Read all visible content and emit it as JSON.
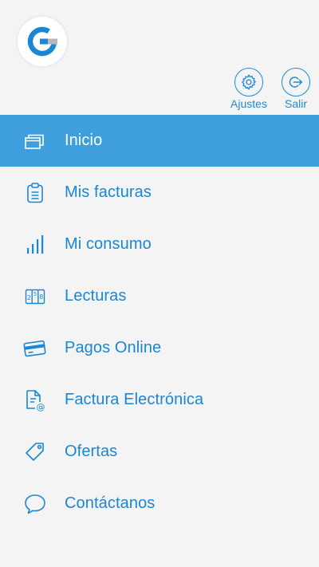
{
  "header": {
    "logo_icon": "brand-logo-icon",
    "actions": [
      {
        "label": "Ajustes",
        "icon": "gear-icon"
      },
      {
        "label": "Salir",
        "icon": "logout-icon"
      }
    ]
  },
  "menu": {
    "active_index": 0,
    "items": [
      {
        "label": "Inicio",
        "icon": "windows-stack-icon"
      },
      {
        "label": "Mis facturas",
        "icon": "clipboard-icon"
      },
      {
        "label": "Mi consumo",
        "icon": "bar-chart-icon"
      },
      {
        "label": "Lecturas",
        "icon": "meter-digits-icon"
      },
      {
        "label": "Pagos Online",
        "icon": "credit-card-icon"
      },
      {
        "label": "Factura Electrónica",
        "icon": "email-document-icon"
      },
      {
        "label": "Ofertas",
        "icon": "tag-icon"
      },
      {
        "label": "Contáctanos",
        "icon": "chat-bubble-icon"
      }
    ]
  },
  "colors": {
    "accent": "#1f8ad6",
    "active_background": "#3f9fdc",
    "background": "#f4f4f4"
  }
}
